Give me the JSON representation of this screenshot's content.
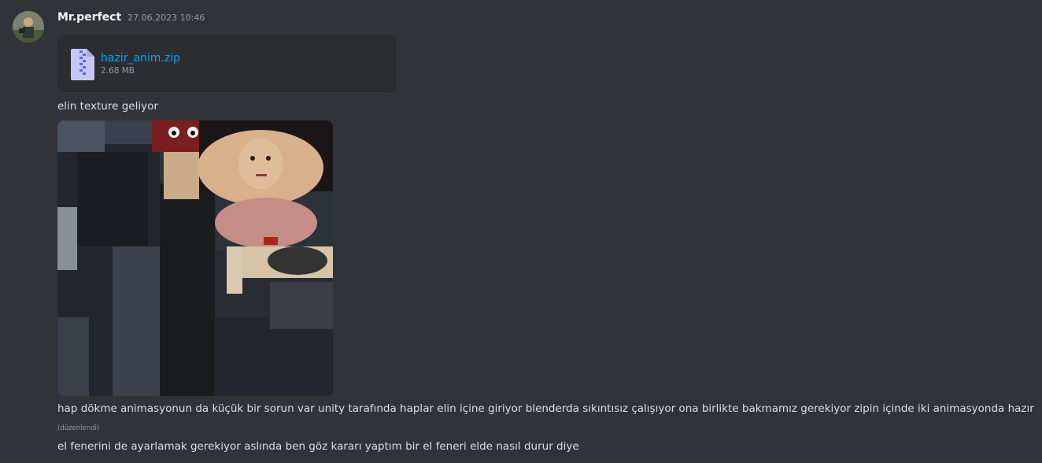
{
  "message": {
    "author": "Mr.perfect",
    "timestamp": "27.06.2023 10:46",
    "attachment": {
      "file_name": "hazir_anim.zip",
      "file_size": "2.68 MB",
      "icon": "zip-file-icon"
    },
    "lines": [
      "elin texture geliyor",
      "hap dökme animasyonun da küçük bir sorun var unity tarafında haplar elin içine giriyor blenderda sıkıntısız çalışıyor ona birlikte bakmamız gerekiyor zipin içinde iki animasyonda hazır",
      "el fenerini de ayarlamak gerekiyor aslında ben göz kararı yaptım bir el feneri elde nasıl durur diye"
    ],
    "edited_label": "(düzenlendi)",
    "image_alt": "texture atlas image"
  },
  "colors": {
    "background": "#313338",
    "link": "#00a8fc",
    "muted": "#949ba4",
    "text": "#dbdee1"
  }
}
